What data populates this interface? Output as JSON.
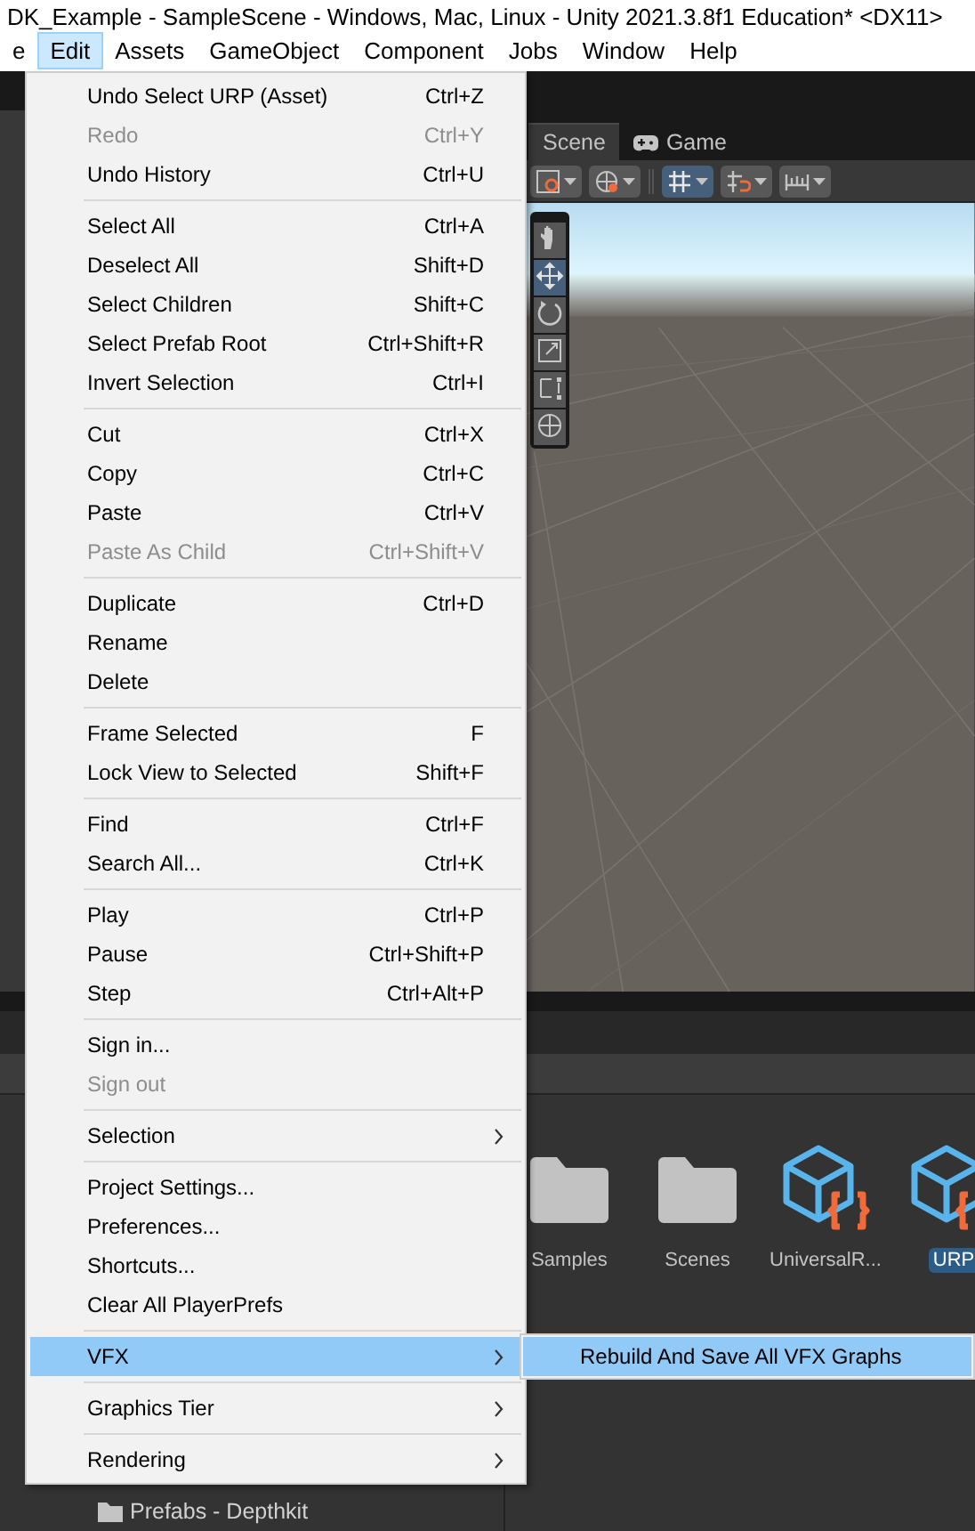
{
  "window": {
    "title": "DK_Example - SampleScene - Windows, Mac, Linux - Unity 2021.3.8f1 Education* <DX11>"
  },
  "menu_bar": [
    {
      "label": "e",
      "selected": false
    },
    {
      "label": "Edit",
      "selected": true
    },
    {
      "label": "Assets",
      "selected": false
    },
    {
      "label": "GameObject",
      "selected": false
    },
    {
      "label": "Component",
      "selected": false
    },
    {
      "label": "Jobs",
      "selected": false
    },
    {
      "label": "Window",
      "selected": false
    },
    {
      "label": "Help",
      "selected": false
    }
  ],
  "scene_tabs": [
    {
      "label": "Scene",
      "selected": true
    },
    {
      "label": "Game",
      "selected": false
    }
  ],
  "edit_menu": {
    "groups": [
      [
        {
          "label": "Undo Select URP (Asset)",
          "shortcut": "Ctrl+Z",
          "disabled": false,
          "highlighted": false,
          "submenu": false
        },
        {
          "label": "Redo",
          "shortcut": "Ctrl+Y",
          "disabled": true,
          "highlighted": false,
          "submenu": false
        },
        {
          "label": "Undo History",
          "shortcut": "Ctrl+U",
          "disabled": false,
          "highlighted": false,
          "submenu": false
        }
      ],
      [
        {
          "label": "Select All",
          "shortcut": "Ctrl+A",
          "disabled": false,
          "highlighted": false,
          "submenu": false
        },
        {
          "label": "Deselect All",
          "shortcut": "Shift+D",
          "disabled": false,
          "highlighted": false,
          "submenu": false
        },
        {
          "label": "Select Children",
          "shortcut": "Shift+C",
          "disabled": false,
          "highlighted": false,
          "submenu": false
        },
        {
          "label": "Select Prefab Root",
          "shortcut": "Ctrl+Shift+R",
          "disabled": false,
          "highlighted": false,
          "submenu": false
        },
        {
          "label": "Invert Selection",
          "shortcut": "Ctrl+I",
          "disabled": false,
          "highlighted": false,
          "submenu": false
        }
      ],
      [
        {
          "label": "Cut",
          "shortcut": "Ctrl+X",
          "disabled": false,
          "highlighted": false,
          "submenu": false
        },
        {
          "label": "Copy",
          "shortcut": "Ctrl+C",
          "disabled": false,
          "highlighted": false,
          "submenu": false
        },
        {
          "label": "Paste",
          "shortcut": "Ctrl+V",
          "disabled": false,
          "highlighted": false,
          "submenu": false
        },
        {
          "label": "Paste As Child",
          "shortcut": "Ctrl+Shift+V",
          "disabled": true,
          "highlighted": false,
          "submenu": false
        }
      ],
      [
        {
          "label": "Duplicate",
          "shortcut": "Ctrl+D",
          "disabled": false,
          "highlighted": false,
          "submenu": false
        },
        {
          "label": "Rename",
          "disabled": false,
          "highlighted": false,
          "submenu": false
        },
        {
          "label": "Delete",
          "disabled": false,
          "highlighted": false,
          "submenu": false
        }
      ],
      [
        {
          "label": "Frame Selected",
          "shortcut": "F",
          "disabled": false,
          "highlighted": false,
          "submenu": false
        },
        {
          "label": "Lock View to Selected",
          "shortcut": "Shift+F",
          "disabled": false,
          "highlighted": false,
          "submenu": false
        }
      ],
      [
        {
          "label": "Find",
          "shortcut": "Ctrl+F",
          "disabled": false,
          "highlighted": false,
          "submenu": false
        },
        {
          "label": "Search All...",
          "shortcut": "Ctrl+K",
          "disabled": false,
          "highlighted": false,
          "submenu": false
        }
      ],
      [
        {
          "label": "Play",
          "shortcut": "Ctrl+P",
          "disabled": false,
          "highlighted": false,
          "submenu": false
        },
        {
          "label": "Pause",
          "shortcut": "Ctrl+Shift+P",
          "disabled": false,
          "highlighted": false,
          "submenu": false
        },
        {
          "label": "Step",
          "shortcut": "Ctrl+Alt+P",
          "disabled": false,
          "highlighted": false,
          "submenu": false
        }
      ],
      [
        {
          "label": "Sign in...",
          "disabled": false,
          "highlighted": false,
          "submenu": false
        },
        {
          "label": "Sign out",
          "disabled": true,
          "highlighted": false,
          "submenu": false
        }
      ],
      [
        {
          "label": "Selection",
          "disabled": false,
          "highlighted": false,
          "submenu": true
        }
      ],
      [
        {
          "label": "Project Settings...",
          "disabled": false,
          "highlighted": false,
          "submenu": false
        },
        {
          "label": "Preferences...",
          "disabled": false,
          "highlighted": false,
          "submenu": false
        },
        {
          "label": "Shortcuts...",
          "disabled": false,
          "highlighted": false,
          "submenu": false
        },
        {
          "label": "Clear All PlayerPrefs",
          "disabled": false,
          "highlighted": false,
          "submenu": false
        }
      ],
      [
        {
          "label": "VFX",
          "disabled": false,
          "highlighted": true,
          "submenu": true
        }
      ],
      [
        {
          "label": "Graphics Tier",
          "disabled": false,
          "highlighted": false,
          "submenu": true
        }
      ],
      [
        {
          "label": "Rendering",
          "disabled": false,
          "highlighted": false,
          "submenu": true
        }
      ]
    ]
  },
  "vfx_submenu": {
    "items": [
      {
        "label": "Rebuild And Save All VFX Graphs",
        "highlighted": true
      }
    ]
  },
  "project_assets": [
    {
      "kind": "folder",
      "label": "Samples",
      "selected": false
    },
    {
      "kind": "folder",
      "label": "Scenes",
      "selected": false
    },
    {
      "kind": "package",
      "label": "UniversalR...",
      "selected": false
    },
    {
      "kind": "package",
      "label": "URP",
      "selected": true
    }
  ],
  "project_tree": [
    {
      "label": "Prefabs - Depthkit"
    }
  ]
}
